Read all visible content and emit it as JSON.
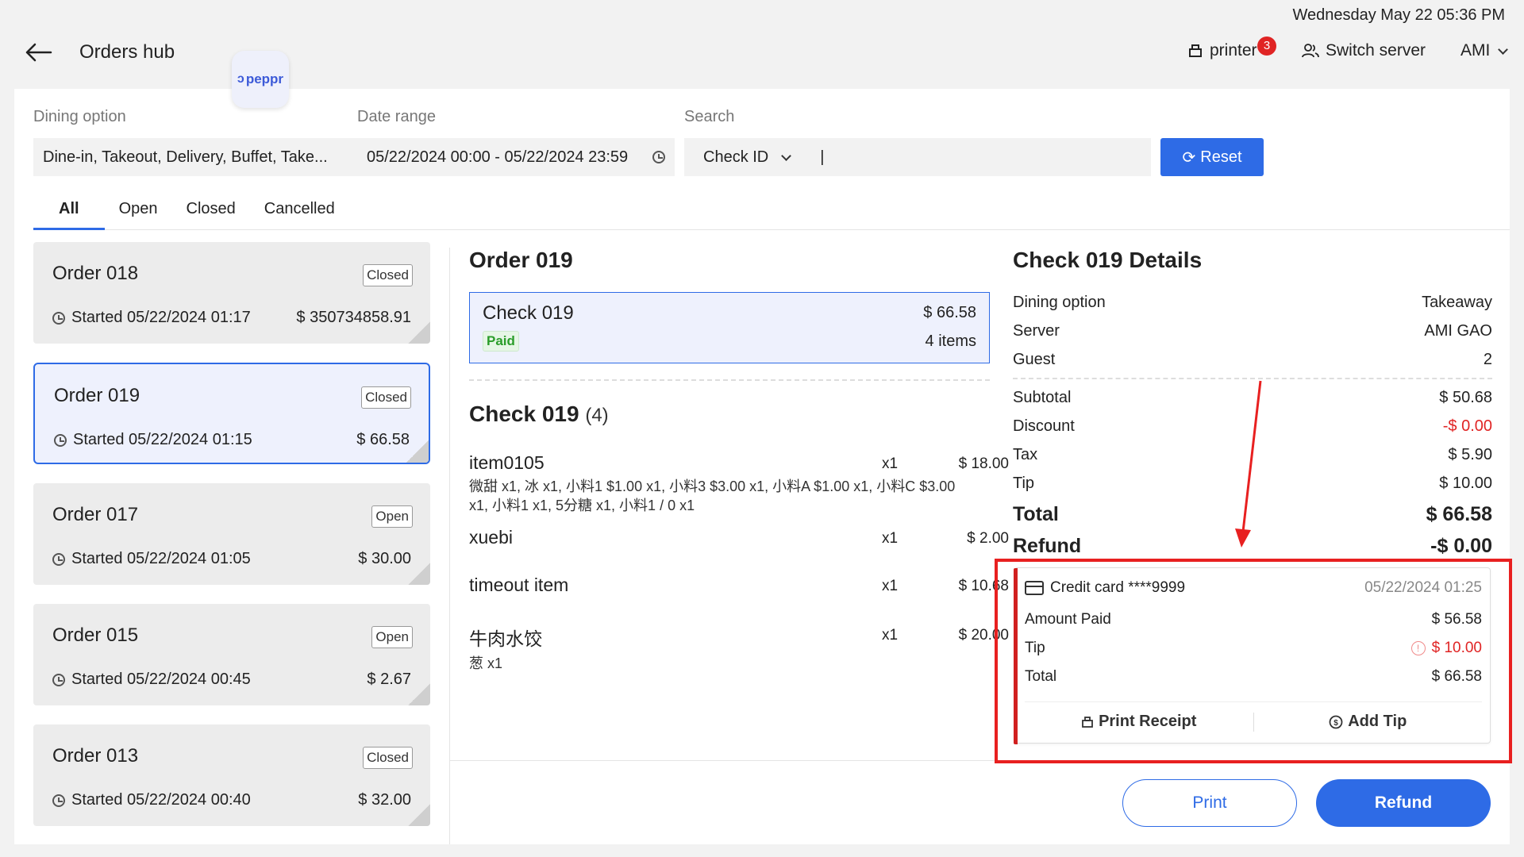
{
  "header": {
    "datetime": "Wednesday May 22 05:36 PM",
    "title": "Orders hub",
    "logo_text": "peppr",
    "printer_label": "printer",
    "printer_badge": "3",
    "switch_server_label": "Switch server",
    "user": "AMI"
  },
  "filters": {
    "dining_label": "Dining option",
    "dining_value": "Dine-in, Takeout, Delivery, Buffet, Take...",
    "date_label": "Date range",
    "date_value": "05/22/2024 00:00 - 05/22/2024 23:59",
    "search_label": "Search",
    "search_type": "Check ID",
    "search_value": "|",
    "reset_label": "Reset"
  },
  "tabs": [
    "All",
    "Open",
    "Closed",
    "Cancelled"
  ],
  "orders": [
    {
      "name": "Order 018",
      "status": "Closed",
      "started": "Started 05/22/2024 01:17",
      "amount": "$ 350734858.91"
    },
    {
      "name": "Order 019",
      "status": "Closed",
      "started": "Started 05/22/2024 01:15",
      "amount": "$ 66.58"
    },
    {
      "name": "Order 017",
      "status": "Open",
      "started": "Started 05/22/2024 01:05",
      "amount": "$ 30.00"
    },
    {
      "name": "Order 015",
      "status": "Open",
      "started": "Started 05/22/2024 00:45",
      "amount": "$ 2.67"
    },
    {
      "name": "Order 013",
      "status": "Closed",
      "started": "Started 05/22/2024 00:40",
      "amount": "$ 32.00"
    }
  ],
  "order_detail": {
    "title": "Order 019",
    "check_card": {
      "name": "Check 019",
      "amount": "$ 66.58",
      "tag": "Paid",
      "items": "4 items"
    },
    "check_title": "Check 019",
    "check_count": "(4)",
    "items": [
      {
        "name": "item0105",
        "qty": "x1",
        "price": "$ 18.00",
        "mods": "微甜 x1, 冰 x1, 小料1 $1.00 x1, 小料3 $3.00 x1, 小料A $1.00 x1, 小料C $3.00 x1, 小料1 x1, 5分糖 x1, 小料1 / 0 x1"
      },
      {
        "name": "xuebi",
        "qty": "x1",
        "price": "$ 2.00",
        "mods": ""
      },
      {
        "name": "timeout item",
        "qty": "x1",
        "price": "$ 10.68",
        "mods": ""
      },
      {
        "name": "牛肉水饺",
        "qty": "x1",
        "price": "$ 20.00",
        "mods": "葱 x1"
      }
    ]
  },
  "check_details": {
    "title": "Check 019 Details",
    "dining_option": {
      "label": "Dining option",
      "value": "Takeaway"
    },
    "server": {
      "label": "Server",
      "value": "AMI GAO"
    },
    "guest": {
      "label": "Guest",
      "value": "2"
    },
    "subtotal": {
      "label": "Subtotal",
      "value": "$ 50.68"
    },
    "discount": {
      "label": "Discount",
      "value": "-$ 0.00"
    },
    "tax": {
      "label": "Tax",
      "value": "$ 5.90"
    },
    "tip": {
      "label": "Tip",
      "value": "$ 10.00"
    },
    "total": {
      "label": "Total",
      "value": "$ 66.58"
    },
    "refund": {
      "label": "Refund",
      "value": "-$ 0.00"
    },
    "payment": {
      "method": "Credit card ****9999",
      "datetime": "05/22/2024 01:25",
      "amount_paid_label": "Amount Paid",
      "amount_paid": "$ 56.58",
      "tip_label": "Tip",
      "tip": "$ 10.00",
      "total_label": "Total",
      "total": "$ 66.58",
      "print_receipt": "Print Receipt",
      "add_tip": "Add Tip"
    }
  },
  "actions": {
    "print": "Print",
    "refund": "Refund"
  },
  "colors": {
    "accent": "#2e6be6",
    "negative": "#e02424",
    "paid": "#2a9d2a",
    "highlight": "#e82020"
  }
}
